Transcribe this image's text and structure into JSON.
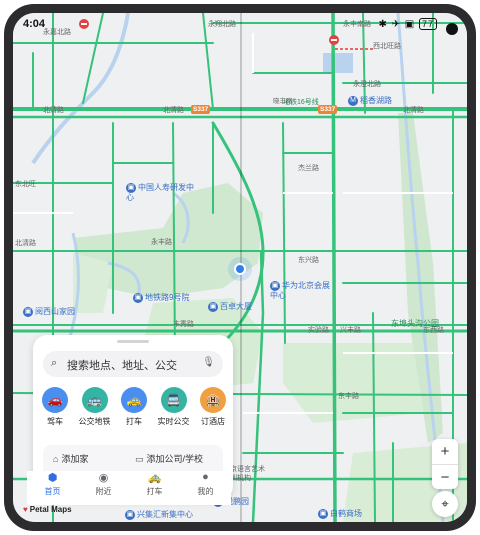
{
  "status_bar": {
    "time": "4:04",
    "icons": "✱ ✈ ▣",
    "battery": "77"
  },
  "map": {
    "labels": {
      "l1": "北清路",
      "l2": "北清路",
      "l3": "北清路",
      "l4": "地铁16号线",
      "l5": "稻香湖路",
      "l6": "杰兰路",
      "l7": "东兴路",
      "l8": "中国人寿研发中心",
      "l9": "百卓大厦",
      "l10": "华为北京会展中心",
      "l11": "地铁路9号院",
      "l12": "东埠头沟公园",
      "l13": "阅西山家园",
      "l14": "东北旺",
      "l15": "永丰路",
      "l16": "丰秀路",
      "l17": "实验路",
      "l18": "兴丰路",
      "l19": "稻香湖景酒店",
      "l20": "东西路",
      "l21": "北清路",
      "l22": "旗路路",
      "l23": "晓丰路",
      "l24": "丰顺路",
      "l25": "东丰路",
      "l26": "北京语言艺术",
      "l27": "培训机构",
      "l28": "兴集汇新集中心",
      "l29": "白鹤商场",
      "l30": "锐鹏园",
      "l31": "永翔北路",
      "l32": "永丰南路",
      "l33": "西北旺路",
      "l34": "永嘉北路",
      "l35": "丰贤路",
      "l36": "永澄北路"
    },
    "shields": [
      "S337",
      "S337"
    ]
  },
  "panel": {
    "search_placeholder": "搜索地点、地址、公交",
    "categories": [
      {
        "label": "驾车",
        "color": "#4a8ef0",
        "icon": "car-icon",
        "glyph": "🚗"
      },
      {
        "label": "公交地铁",
        "color": "#34b5a4",
        "icon": "bus-icon",
        "glyph": "🚌"
      },
      {
        "label": "打车",
        "color": "#4a8ef0",
        "icon": "taxi-icon",
        "glyph": "🚕"
      },
      {
        "label": "实时公交",
        "color": "#34b5a4",
        "icon": "realtime-bus-icon",
        "glyph": "🚍"
      },
      {
        "label": "订酒店",
        "color": "#f0a040",
        "icon": "hotel-icon",
        "glyph": "🏨"
      }
    ],
    "quick": {
      "home": "添加家",
      "work": "添加公司/学校"
    }
  },
  "nav": [
    {
      "label": "首页",
      "glyph": "⬢",
      "icon": "home-icon",
      "active": true
    },
    {
      "label": "附近",
      "glyph": "◉",
      "icon": "nearby-icon",
      "active": false
    },
    {
      "label": "打车",
      "glyph": "🚕",
      "icon": "taxi-nav-icon",
      "active": false
    },
    {
      "label": "我的",
      "glyph": "●",
      "icon": "profile-icon",
      "active": false
    }
  ],
  "brand": "Petal Maps",
  "zoom": {
    "in": "+",
    "out": "−"
  },
  "colors": {
    "road_green": "#35c27a",
    "accent": "#2f6fe0"
  }
}
